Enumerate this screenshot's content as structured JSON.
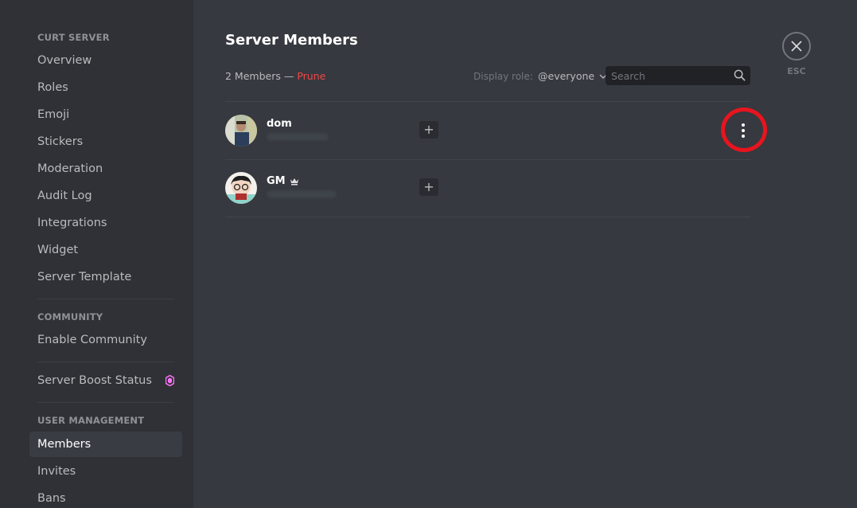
{
  "sidebar": {
    "sections": [
      {
        "header": "CURT SERVER",
        "items": [
          "Overview",
          "Roles",
          "Emoji",
          "Stickers",
          "Moderation",
          "Audit Log",
          "Integrations",
          "Widget",
          "Server Template"
        ]
      },
      {
        "header": "COMMUNITY",
        "items": [
          "Enable Community"
        ]
      },
      {
        "header": "",
        "items": [
          "Server Boost Status"
        ]
      },
      {
        "header": "USER MANAGEMENT",
        "items": [
          "Members",
          "Invites",
          "Bans"
        ]
      }
    ],
    "active_item": "Members",
    "boost_icon_color": "#ff73fa"
  },
  "main": {
    "title": "Server Members",
    "member_count": "2 Members",
    "separator": " — ",
    "prune_label": "Prune",
    "display_role_label": "Display role:",
    "display_role_value": "@everyone",
    "search_placeholder": "Search",
    "members": [
      {
        "name": "dom",
        "owner": false
      },
      {
        "name": "GM",
        "owner": true
      }
    ],
    "close_label": "ESC",
    "accent_red": "#f04747",
    "highlight_color": "#e8141e"
  }
}
